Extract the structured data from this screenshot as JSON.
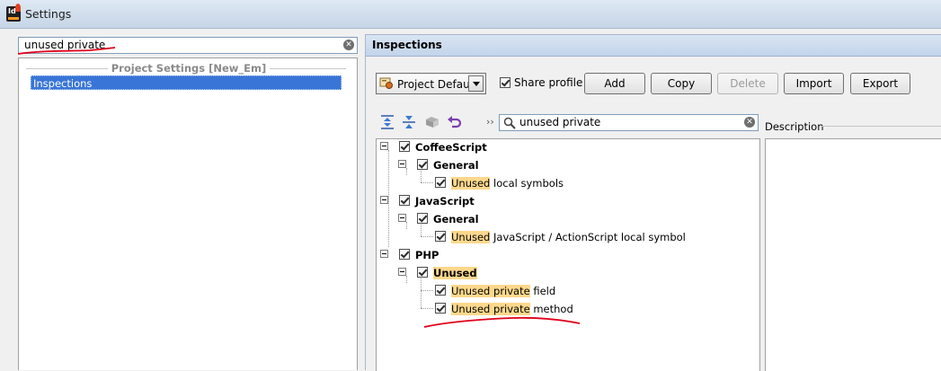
{
  "window": {
    "title": "Settings"
  },
  "left": {
    "search_value": "unused private",
    "group_header": "Project Settings [New_Em]",
    "nav_items": [
      {
        "label": "Inspections"
      }
    ]
  },
  "right": {
    "header": "Inspections",
    "profile": {
      "selected": "Project Default"
    },
    "share_profile": {
      "label": "Share profile",
      "checked": true
    },
    "buttons": {
      "add": "Add",
      "copy": "Copy",
      "delete": "Delete",
      "import": "Import",
      "export": "Export"
    },
    "filter_value": "unused private",
    "description_label": "Description",
    "tree": {
      "coffeescript": {
        "label": "CoffeeScript",
        "general": "General",
        "item_hl": "Unused",
        "item_rest": " local symbols"
      },
      "javascript": {
        "label": "JavaScript",
        "general": "General",
        "item_hl": "Unused",
        "item_rest": " JavaScript / ActionScript local symbol"
      },
      "php": {
        "label": "PHP",
        "group_hl": "Unused",
        "items": [
          {
            "hl": "Unused private",
            "rest": " field"
          },
          {
            "hl": "Unused private",
            "rest": " method"
          }
        ]
      }
    }
  },
  "colors": {
    "selection": "#3875d7",
    "highlight": "#fdd88c",
    "annotation": "#e0001a"
  },
  "icons": [
    "app-icon",
    "clear-icon",
    "profile-icon",
    "dropdown-arrow-icon",
    "expand-all-icon",
    "collapse-all-icon",
    "reset-icon",
    "undo-icon",
    "search-icon"
  ]
}
